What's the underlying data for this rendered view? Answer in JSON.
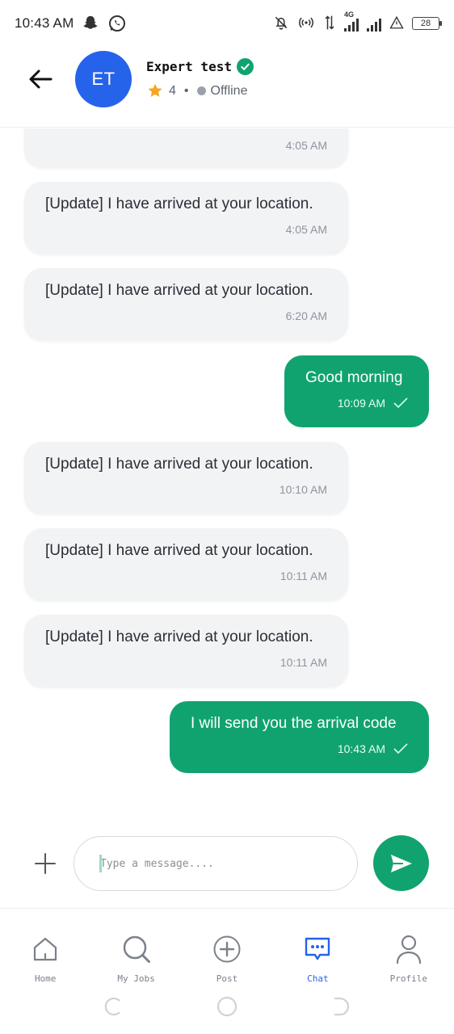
{
  "status_bar": {
    "time": "10:43 AM",
    "network_label": "4G",
    "battery": "28"
  },
  "header": {
    "avatar_initials": "ET",
    "contact_name": "Expert test",
    "rating": "4",
    "separator": "•",
    "presence": "Offline"
  },
  "messages": [
    {
      "direction": "in",
      "text": "",
      "time": "4:05 AM"
    },
    {
      "direction": "in",
      "text": "[Update] I have arrived at your location.",
      "time": "4:05 AM"
    },
    {
      "direction": "in",
      "text": "[Update] I have arrived at your location.",
      "time": "6:20 AM"
    },
    {
      "direction": "out",
      "text": "Good morning",
      "time": "10:09 AM"
    },
    {
      "direction": "in",
      "text": "[Update] I have arrived at your location.",
      "time": "10:10 AM"
    },
    {
      "direction": "in",
      "text": "[Update] I have arrived at your location.",
      "time": "10:11 AM"
    },
    {
      "direction": "in",
      "text": "[Update] I have arrived at your location.",
      "time": "10:11 AM"
    },
    {
      "direction": "out",
      "text": "I will send you the arrival code",
      "time": "10:43 AM"
    }
  ],
  "composer": {
    "placeholder": "Type a message....",
    "value": ""
  },
  "nav": {
    "items": [
      {
        "label": "Home",
        "icon": "home-icon"
      },
      {
        "label": "My Jobs",
        "icon": "search-icon"
      },
      {
        "label": "Post",
        "icon": "plus-circle-icon"
      },
      {
        "label": "Chat",
        "icon": "chat-bubble-icon",
        "active": true
      },
      {
        "label": "Profile",
        "icon": "person-icon"
      }
    ]
  },
  "colors": {
    "accent_green": "#11a36f",
    "avatar_blue": "#2563eb",
    "incoming_bubble": "#f1f3f5"
  }
}
